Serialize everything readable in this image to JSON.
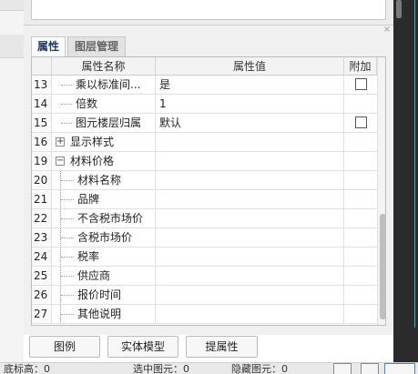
{
  "tabs": [
    {
      "label": "属性",
      "active": true
    },
    {
      "label": "图层管理",
      "active": false
    }
  ],
  "close_label": "×",
  "columns": {
    "name": "属性名称",
    "value": "属性值",
    "extra": "附加"
  },
  "rows": [
    {
      "num": "13",
      "name": "乘以标准间...",
      "value": "是",
      "checkbox": true,
      "level": 2
    },
    {
      "num": "14",
      "name": "倍数",
      "value": "1",
      "checkbox": false,
      "level": 2
    },
    {
      "num": "15",
      "name": "图元楼层归属",
      "value": "默认",
      "checkbox": true,
      "level": 2
    },
    {
      "num": "16",
      "name": "显示样式",
      "value": "",
      "checkbox": false,
      "level": 1,
      "expander": "+"
    },
    {
      "num": "19",
      "name": "材料价格",
      "value": "",
      "checkbox": false,
      "level": 1,
      "expander": "−"
    },
    {
      "num": "20",
      "name": "材料名称",
      "value": "",
      "checkbox": false,
      "level": 3
    },
    {
      "num": "21",
      "name": "品牌",
      "value": "",
      "checkbox": false,
      "level": 3
    },
    {
      "num": "22",
      "name": "不含税市场价",
      "value": "",
      "checkbox": false,
      "level": 3
    },
    {
      "num": "23",
      "name": "含税市场价",
      "value": "",
      "checkbox": false,
      "level": 3
    },
    {
      "num": "24",
      "name": "税率",
      "value": "",
      "checkbox": false,
      "level": 3
    },
    {
      "num": "25",
      "name": "供应商",
      "value": "",
      "checkbox": false,
      "level": 3
    },
    {
      "num": "26",
      "name": "报价时间",
      "value": "",
      "checkbox": false,
      "level": 3
    },
    {
      "num": "27",
      "name": "其他说明",
      "value": "",
      "checkbox": false,
      "level": 3
    }
  ],
  "buttons": {
    "legend": "图例",
    "solid_model": "实体模型",
    "extract_props": "提属性"
  },
  "status": {
    "base_elevation": "底标高：0",
    "selected": "选中图元：0",
    "hidden": "隐藏图元：0"
  },
  "icons": [
    "grid-view-icon",
    "angle-icon",
    "window-select-icon"
  ]
}
